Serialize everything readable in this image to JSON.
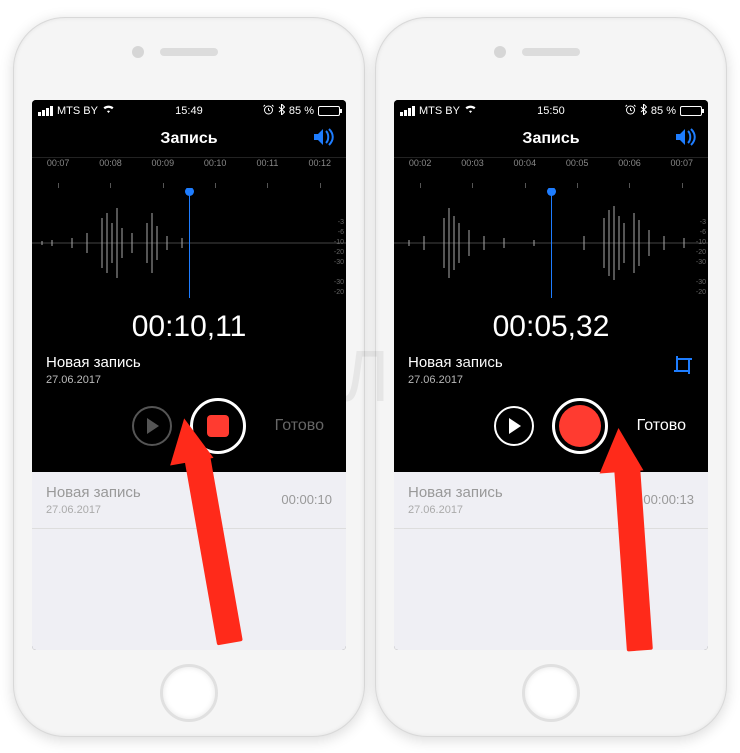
{
  "phones": [
    {
      "status": {
        "carrier": "MTS BY",
        "wifi": true,
        "time": "15:49",
        "alarm": true,
        "bt": true,
        "battery_pct": "85 %"
      },
      "title": "Запись",
      "ruler_ticks": [
        "00:07",
        "00:08",
        "00:09",
        "00:10",
        "00:11",
        "00:12"
      ],
      "big_time": "00:10,11",
      "recording": {
        "title": "Новая запись",
        "date": "27.06.2017"
      },
      "show_crop": false,
      "play_enabled": false,
      "record_mode": "stop",
      "done_label": "Готово",
      "done_enabled": false,
      "list": {
        "title": "Новая запись",
        "date": "27.06.2017",
        "duration": "00:00:10"
      }
    },
    {
      "status": {
        "carrier": "MTS BY",
        "wifi": true,
        "time": "15:50",
        "alarm": true,
        "bt": true,
        "battery_pct": "85 %"
      },
      "title": "Запись",
      "ruler_ticks": [
        "00:02",
        "00:03",
        "00:04",
        "00:05",
        "00:06",
        "00:07"
      ],
      "big_time": "00:05,32",
      "recording": {
        "title": "Новая запись",
        "date": "27.06.2017"
      },
      "show_crop": true,
      "play_enabled": true,
      "record_mode": "record",
      "done_label": "Готово",
      "done_enabled": true,
      "list": {
        "title": "Новая запись",
        "date": "27.06.2017",
        "duration": "00:00:13"
      }
    }
  ],
  "watermark": "ЯБЛЫК"
}
